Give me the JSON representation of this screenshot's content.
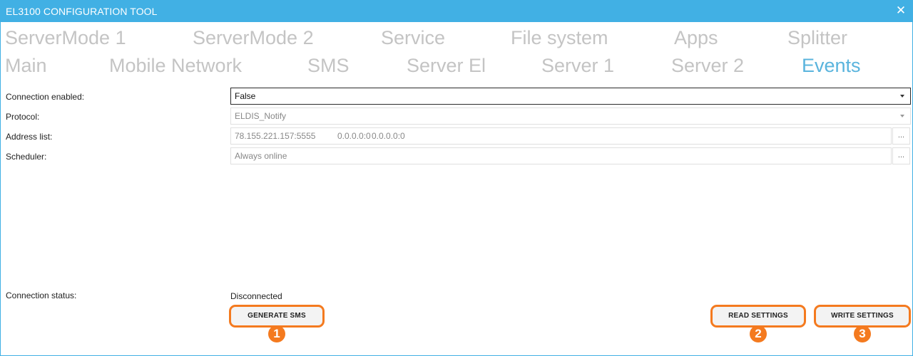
{
  "window": {
    "title": "EL3100 CONFIGURATION TOOL",
    "close_glyph": "✕"
  },
  "tabs_row1": [
    {
      "label": "ServerMode 1"
    },
    {
      "label": "ServerMode 2"
    },
    {
      "label": "Service"
    },
    {
      "label": "File system"
    },
    {
      "label": "Apps"
    },
    {
      "label": "Splitter"
    }
  ],
  "tabs_row2": [
    {
      "label": "Main"
    },
    {
      "label": "Mobile Network"
    },
    {
      "label": "SMS"
    },
    {
      "label": "Server El"
    },
    {
      "label": "Server 1"
    },
    {
      "label": "Server 2"
    },
    {
      "label": "Events",
      "active": true
    }
  ],
  "form": {
    "connection_enabled": {
      "label": "Connection enabled:",
      "value": "False"
    },
    "protocol": {
      "label": "Protocol:",
      "value": "ELDIS_Notify"
    },
    "address_list": {
      "label": "Address list:",
      "value1": "78.155.221.157:5555",
      "value2": "0.0.0.0:0",
      "value3": "0.0.0.0:0",
      "button": "..."
    },
    "scheduler": {
      "label": "Scheduler:",
      "value": "Always online",
      "button": "..."
    }
  },
  "status": {
    "label": "Connection status:",
    "value": "Disconnected"
  },
  "buttons": {
    "generate_sms": "GENERATE SMS",
    "read_settings": "READ SETTINGS",
    "write_settings": "WRITE SETTINGS"
  },
  "badges": [
    "1",
    "2",
    "3"
  ],
  "colors": {
    "titlebar": "#41b0e4",
    "active_tab": "#5ab4dd",
    "inactive_tab": "#c4c4c4",
    "highlight": "#f47a1f"
  }
}
